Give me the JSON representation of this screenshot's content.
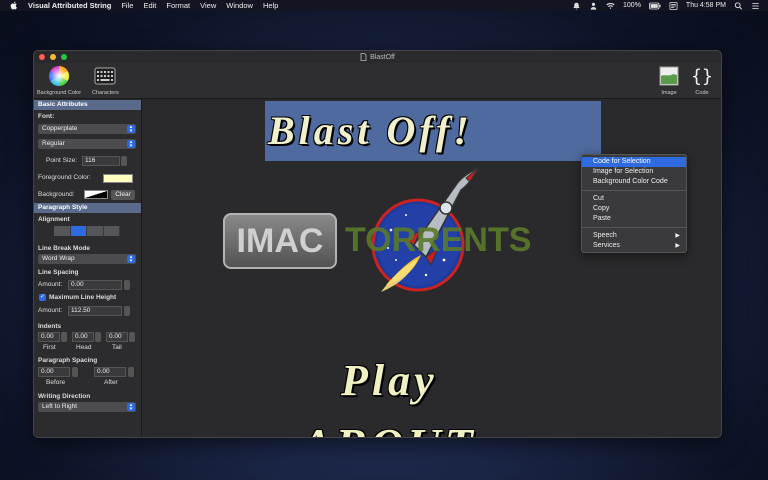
{
  "menubar": {
    "app_name": "Visual Attributed String",
    "menus": [
      "File",
      "Edit",
      "Format",
      "View",
      "Window",
      "Help"
    ],
    "battery": "100%",
    "clock": "Thu 4:58 PM"
  },
  "window": {
    "title": "BlastOff",
    "toolbar": {
      "background_color": "Background Color",
      "characters": "Characters",
      "image": "Image",
      "code": "Code"
    }
  },
  "sidebar": {
    "basic_attributes": "Basic Attributes",
    "font_label": "Font:",
    "font_family": "Copperplate",
    "font_style": "Regular",
    "point_size_label": "Point Size:",
    "point_size": "116",
    "foreground_label": "Foreground Color:",
    "foreground_color": "#ffffc0",
    "background_label": "Background:",
    "clear_button": "Clear",
    "paragraph_style": "Paragraph Style",
    "alignment_label": "Alignment",
    "line_break_label": "Line Break Mode",
    "line_break_value": "Word Wrap",
    "line_spacing_label": "Line Spacing",
    "amount_label": "Amount:",
    "line_spacing_amount": "0.00",
    "max_line_height_label": "Maximum Line Height",
    "max_line_height_amount": "112.50",
    "indents_label": "Indents",
    "indent_first": "0.00",
    "indent_head": "0.00",
    "indent_tail": "0.00",
    "first_label": "First",
    "head_label": "Head",
    "tail_label": "Tail",
    "paragraph_spacing_label": "Paragraph Spacing",
    "spacing_before": "0.00",
    "spacing_after": "0.00",
    "before_label": "Before",
    "after_label": "After",
    "writing_direction_label": "Writing Direction",
    "writing_direction_value": "Left to Right"
  },
  "canvas": {
    "blast_off": "Blast Off!",
    "play": "Play",
    "about": "ABOUT",
    "watermark_left": "IMAC",
    "watermark_right": "TORRENTS"
  },
  "context_menu": {
    "items": [
      "Code for Selection",
      "Image for Selection",
      "Background Color Code",
      "Cut",
      "Copy",
      "Paste",
      "Speech",
      "Services"
    ]
  },
  "colors": {
    "accent": "#2e6ae0",
    "section_header": "#5a6a8a",
    "banner": "#4e6a9e",
    "text_fill": "#f0f0c0"
  }
}
